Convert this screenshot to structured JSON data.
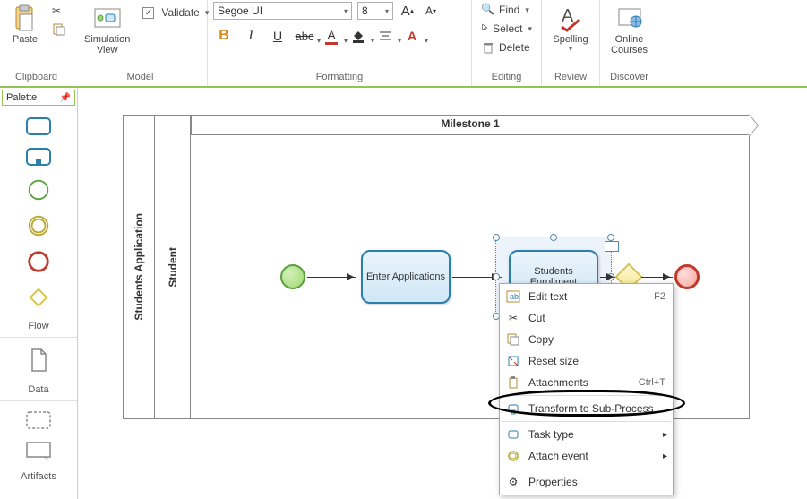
{
  "ribbon": {
    "groups": {
      "clipboard": {
        "label": "Clipboard",
        "paste": "Paste"
      },
      "model": {
        "label": "Model",
        "simulation_view": "Simulation\nView",
        "validate": "Validate"
      },
      "formatting": {
        "label": "Formatting",
        "font": "Segoe UI",
        "size": "8"
      },
      "editing": {
        "label": "Editing",
        "find": "Find",
        "select": "Select",
        "delete": "Delete"
      },
      "review": {
        "label": "Review",
        "spelling": "Spelling"
      },
      "discover": {
        "label": "Discover",
        "online_courses": "Online\nCourses"
      }
    }
  },
  "palette": {
    "title": "Palette",
    "sections": {
      "flow": "Flow",
      "data": "Data",
      "artifacts": "Artifacts"
    }
  },
  "diagram": {
    "milestone": "Milestone 1",
    "pool": "Students Application",
    "lane": "Student",
    "task1": "Enter Applications",
    "task2": "Students Enrollment"
  },
  "context_menu": {
    "edit_text": "Edit text",
    "edit_text_sc": "F2",
    "cut": "Cut",
    "copy": "Copy",
    "reset_size": "Reset size",
    "attachments": "Attachments",
    "attachments_sc": "Ctrl+T",
    "transform": "Transform to Sub-Process",
    "task_type": "Task type",
    "attach_event": "Attach event",
    "properties": "Properties"
  }
}
